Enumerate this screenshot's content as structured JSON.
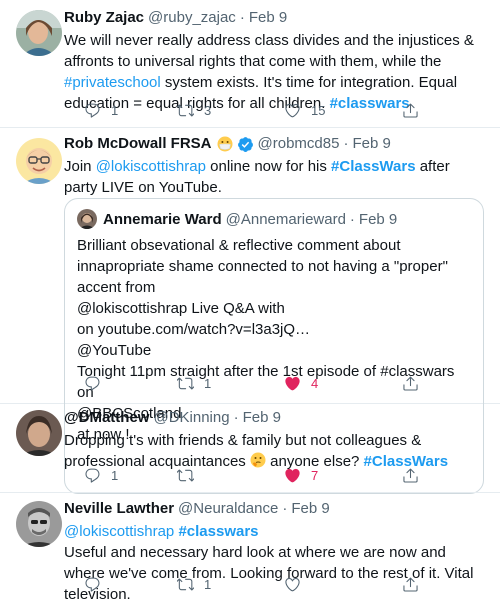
{
  "tweets": [
    {
      "name": "Ruby Zajac",
      "handle": "@ruby_zajac",
      "date": "Feb 9",
      "text": {
        "p1": "We will never really address class divides and the injustices & affronts to universal rights that come with them, while the ",
        "tag1": "#privateschool",
        "p2": " system exists. It's time for integration. Equal education = equal rights for all children. ",
        "tag2": "#classwars"
      },
      "replies": "1",
      "retweets": "3",
      "likes": "15"
    },
    {
      "name": "Rob McDowall FRSA",
      "handle": "@robmcd85",
      "date": "Feb 9",
      "text": {
        "p1": "Join ",
        "mention": "@lokiscottishrap",
        "p2": " online now for his ",
        "tag": "#ClassWars",
        "p3": " after party LIVE on YouTube."
      },
      "quote": {
        "name": "Annemarie Ward",
        "handle": "@Annemarieward",
        "date": "Feb 9",
        "text": "Brilliant obsevational & reflective comment about innapropriate shame connected to not having a \"proper\" accent from\n@lokiscottishrap Live Q&A with\n on youtube.com/watch?v=l3a3jQ…\n@YouTube\nTonight 11pm straight after the 1st episode of #classwars on\n@BBCScotland\n at now !"
      },
      "replies": "",
      "retweets": "1",
      "likes": "4"
    },
    {
      "name": "@DMatthew",
      "handle": "@DKinning",
      "date": "Feb 9",
      "text": {
        "p1": "Dropping t's with friends & family but not colleagues & professional acquaintances ",
        "p2": " anyone else? ",
        "tag": "#ClassWars"
      },
      "replies": "1",
      "retweets": "",
      "likes": "7"
    },
    {
      "name": "Neville Lawther",
      "handle": "@Neuraldance",
      "date": "Feb 9",
      "text": {
        "mention": "@lokiscottishrap",
        "tag": "#classwars",
        "body": "Useful and necessary hard look at where we are now and where we've come from. Looking forward to the rest of it. Vital television."
      },
      "replies": "",
      "retweets": "1",
      "likes": ""
    }
  ],
  "icons": {
    "reply": "reply-icon",
    "retweet": "retweet-icon",
    "like": "heart-icon",
    "share": "share-icon",
    "verified": "verified-badge-icon",
    "mask_emoji": "face-with-mask-emoji",
    "thinking_emoji": "thinking-face-emoji"
  },
  "colors": {
    "link": "#1d9bf0",
    "secondary": "#536471",
    "like_active": "#e0245e",
    "divider": "#e6ecf0"
  }
}
